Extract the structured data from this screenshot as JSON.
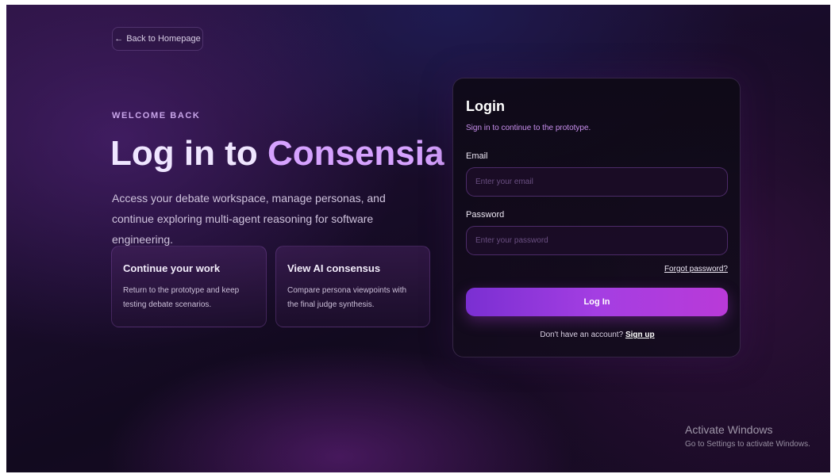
{
  "back_button": {
    "arrow": "←",
    "label": "Back to Homepage"
  },
  "hero": {
    "eyebrow": "WELCOME BACK",
    "title_part1": "Log in to ",
    "title_part2": "Consensia",
    "description": "Access your debate workspace, manage personas, and continue exploring multi-agent reasoning for software engineering."
  },
  "features": [
    {
      "title": "Continue your work",
      "text": "Return to the prototype and keep testing debate scenarios."
    },
    {
      "title": "View AI consensus",
      "text": "Compare persona viewpoints with the final judge synthesis."
    }
  ],
  "login": {
    "title": "Login",
    "subtitle": "Sign in to continue to the prototype.",
    "email_label": "Email",
    "email_placeholder": "Enter your email",
    "email_value": "",
    "password_label": "Password",
    "password_placeholder": "Enter your password",
    "password_value": "",
    "forgot_label": "Forgot password?",
    "submit_label": "Log In",
    "signup_prompt": "Don't have an account? ",
    "signup_link": "Sign up"
  },
  "watermark": {
    "title": "Activate Windows",
    "subtitle": "Go to Settings to activate Windows."
  },
  "colors": {
    "accent": "#a43ee2",
    "title_highlight": "#d6a2ff",
    "eyebrow": "#c9a6ea"
  }
}
